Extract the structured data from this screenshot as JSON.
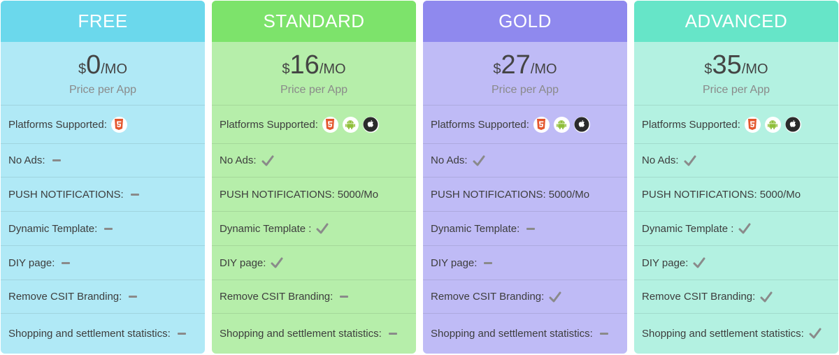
{
  "price_caption": "Price per App",
  "currency_symbol": "$",
  "period": "/MO",
  "labels": {
    "platforms": "Platforms Supported:",
    "no_ads": "No Ads:",
    "push": "PUSH NOTIFICATIONS:",
    "dynamic_template": "Dynamic Template:",
    "dynamic_template_alt": "Dynamic Template :",
    "diy_page": "DIY page:",
    "remove_branding": "Remove CSIT Branding:",
    "shopping_stats": "Shopping and settlement statistics:"
  },
  "plans": [
    {
      "name": "FREE",
      "price": "0",
      "header_color": "#6bd8ec",
      "body_color": "#b0e9f6",
      "platforms": [
        "html5-icon"
      ],
      "dynamic_label_key": "dynamic_template",
      "features": {
        "no_ads": "dash",
        "push": "dash",
        "dynamic_template": "dash",
        "diy_page": "dash",
        "remove_branding": "dash",
        "shopping_stats": "dash"
      },
      "push_value": ""
    },
    {
      "name": "STANDARD",
      "price": "16",
      "header_color": "#7de36b",
      "body_color": "#b6eeaa",
      "platforms": [
        "html5-icon",
        "android-icon",
        "apple-icon"
      ],
      "dynamic_label_key": "dynamic_template_alt",
      "features": {
        "no_ads": "check",
        "push": "text",
        "dynamic_template": "check",
        "diy_page": "check",
        "remove_branding": "dash",
        "shopping_stats": "dash"
      },
      "push_value": "5000/Mo"
    },
    {
      "name": "GOLD",
      "price": "27",
      "header_color": "#8f89ee",
      "body_color": "#bfbbf6",
      "platforms": [
        "html5-icon",
        "android-icon",
        "apple-icon"
      ],
      "dynamic_label_key": "dynamic_template",
      "features": {
        "no_ads": "check",
        "push": "text",
        "dynamic_template": "dash",
        "diy_page": "dash",
        "remove_branding": "check",
        "shopping_stats": "dash"
      },
      "push_value": "5000/Mo"
    },
    {
      "name": "ADVANCED",
      "price": "35",
      "header_color": "#66e5c8",
      "body_color": "#b3f1e1",
      "platforms": [
        "html5-icon",
        "android-icon",
        "apple-icon"
      ],
      "dynamic_label_key": "dynamic_template_alt",
      "features": {
        "no_ads": "check",
        "push": "text",
        "dynamic_template": "check",
        "diy_page": "check",
        "remove_branding": "check",
        "shopping_stats": "check"
      },
      "push_value": "5000/Mo"
    }
  ]
}
